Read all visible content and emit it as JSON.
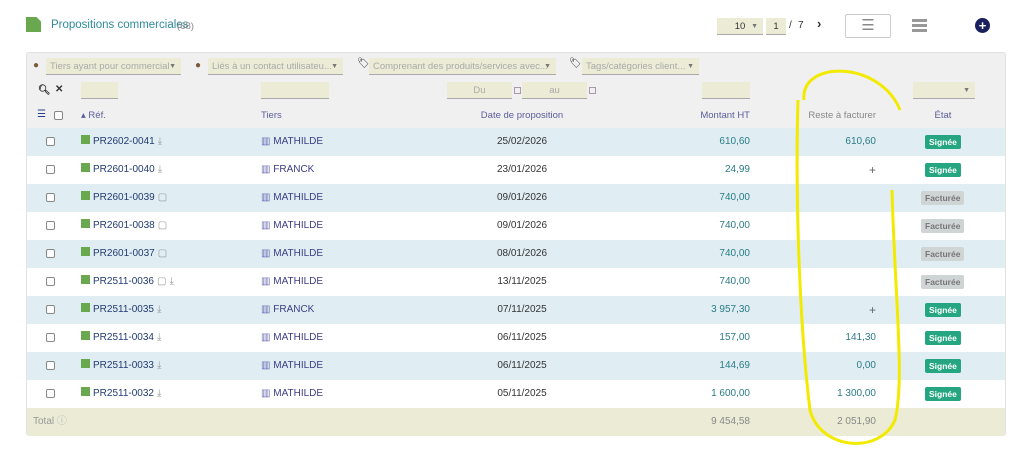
{
  "header": {
    "title": "Propositions commerciales",
    "count": "(68)",
    "page_size": "10",
    "page": "1",
    "page_sep": "/",
    "page_total": "7"
  },
  "filters": {
    "commercial": "Tiers ayant pour commercial",
    "contact": "Liés à un contact utilisateu...",
    "products": "Comprenant des produits/services avec...",
    "tags": "Tags/catégories client...",
    "date_from": "Du",
    "date_to": "au"
  },
  "columns": {
    "ref": "Réf.",
    "tiers": "Tiers",
    "date": "Date de proposition",
    "montant": "Montant HT",
    "reste": "Reste à facturer",
    "etat": "État"
  },
  "rows": [
    {
      "ref": "PR2602-0041",
      "note": false,
      "dl": true,
      "tiers": "MATHILDE",
      "date": "25/02/2026",
      "montant": "610,60",
      "reste": "610,60",
      "etat": "Signée"
    },
    {
      "ref": "PR2601-0040",
      "note": false,
      "dl": true,
      "tiers": "FRANCK",
      "date": "23/01/2026",
      "montant": "24,99",
      "reste": "+",
      "etat": "Signée"
    },
    {
      "ref": "PR2601-0039",
      "note": true,
      "dl": false,
      "tiers": "MATHILDE",
      "date": "09/01/2026",
      "montant": "740,00",
      "reste": "",
      "etat": "Facturée"
    },
    {
      "ref": "PR2601-0038",
      "note": true,
      "dl": false,
      "tiers": "MATHILDE",
      "date": "09/01/2026",
      "montant": "740,00",
      "reste": "",
      "etat": "Facturée"
    },
    {
      "ref": "PR2601-0037",
      "note": true,
      "dl": false,
      "tiers": "MATHILDE",
      "date": "08/01/2026",
      "montant": "740,00",
      "reste": "",
      "etat": "Facturée"
    },
    {
      "ref": "PR2511-0036",
      "note": true,
      "dl": true,
      "tiers": "MATHILDE",
      "date": "13/11/2025",
      "montant": "740,00",
      "reste": "",
      "etat": "Facturée"
    },
    {
      "ref": "PR2511-0035",
      "note": false,
      "dl": true,
      "tiers": "FRANCK",
      "date": "07/11/2025",
      "montant": "3 957,30",
      "reste": "+",
      "etat": "Signée"
    },
    {
      "ref": "PR2511-0034",
      "note": false,
      "dl": true,
      "tiers": "MATHILDE",
      "date": "06/11/2025",
      "montant": "157,00",
      "reste": "141,30",
      "etat": "Signée"
    },
    {
      "ref": "PR2511-0033",
      "note": false,
      "dl": true,
      "tiers": "MATHILDE",
      "date": "06/11/2025",
      "montant": "144,69",
      "reste": "0,00",
      "etat": "Signée"
    },
    {
      "ref": "PR2511-0032",
      "note": false,
      "dl": true,
      "tiers": "MATHILDE",
      "date": "05/11/2025",
      "montant": "1 600,00",
      "reste": "1 300,00",
      "etat": "Signée"
    }
  ],
  "total": {
    "label": "Total",
    "montant": "9 454,58",
    "reste": "2 051,90"
  },
  "colors": {
    "accent": "#2f8a9a",
    "signee": "#25a580",
    "facturee": "#cfd4d4",
    "row_alt": "#e0eef4",
    "total_bg": "#ebebd6",
    "annotation": "#f2ea00"
  }
}
